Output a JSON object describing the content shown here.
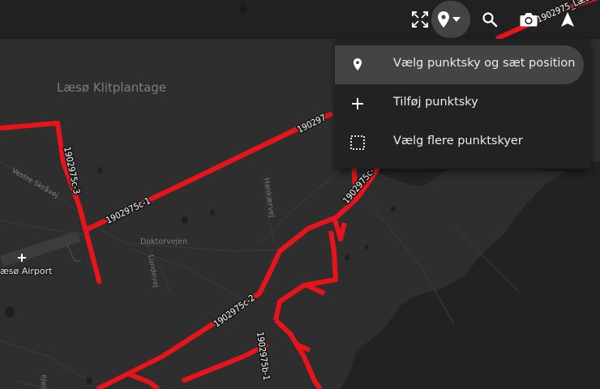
{
  "map": {
    "place_labels": {
      "plantation": "Læsø Klitplantage",
      "airport": "æsø Airport",
      "vestre_skraavej": "Vestre Skråvej",
      "doktorvejen": "Doktorvejen",
      "lundevej": "Lundevej",
      "hankaervej": "Hankærvej",
      "bottom_partial": "ejen"
    },
    "route_labels": {
      "c1": "1902975c-1",
      "c2": "1902975c-2",
      "c3": "1902975c-3",
      "b1": "1902975b-1",
      "top_partial": "190297",
      "east_partial": "1902975c-",
      "toolbar_partial": "1902975_Læsø"
    },
    "colors": {
      "land": "#2f2e2e",
      "sea": "#222223",
      "route": "#e8141c",
      "toolbar": "#212121"
    }
  },
  "toolbar": {
    "buttons": [
      {
        "name": "fullscreen",
        "icon": "fullscreen-icon"
      },
      {
        "name": "location-menu",
        "icon": "map-marker-icon",
        "active": true
      },
      {
        "name": "search",
        "icon": "search-icon"
      },
      {
        "name": "screenshot",
        "icon": "camera-icon"
      },
      {
        "name": "navigate",
        "icon": "navigation-arrow-icon"
      }
    ]
  },
  "menu": {
    "items": [
      {
        "label": "Vælg punktsky og sæt position",
        "icon": "map-marker-icon",
        "selected": true
      },
      {
        "label": "Tilføj punktsky",
        "icon": "plus-icon",
        "selected": false
      },
      {
        "label": "Vælg flere punktskyer",
        "icon": "dashed-selection-icon",
        "selected": false
      }
    ]
  }
}
